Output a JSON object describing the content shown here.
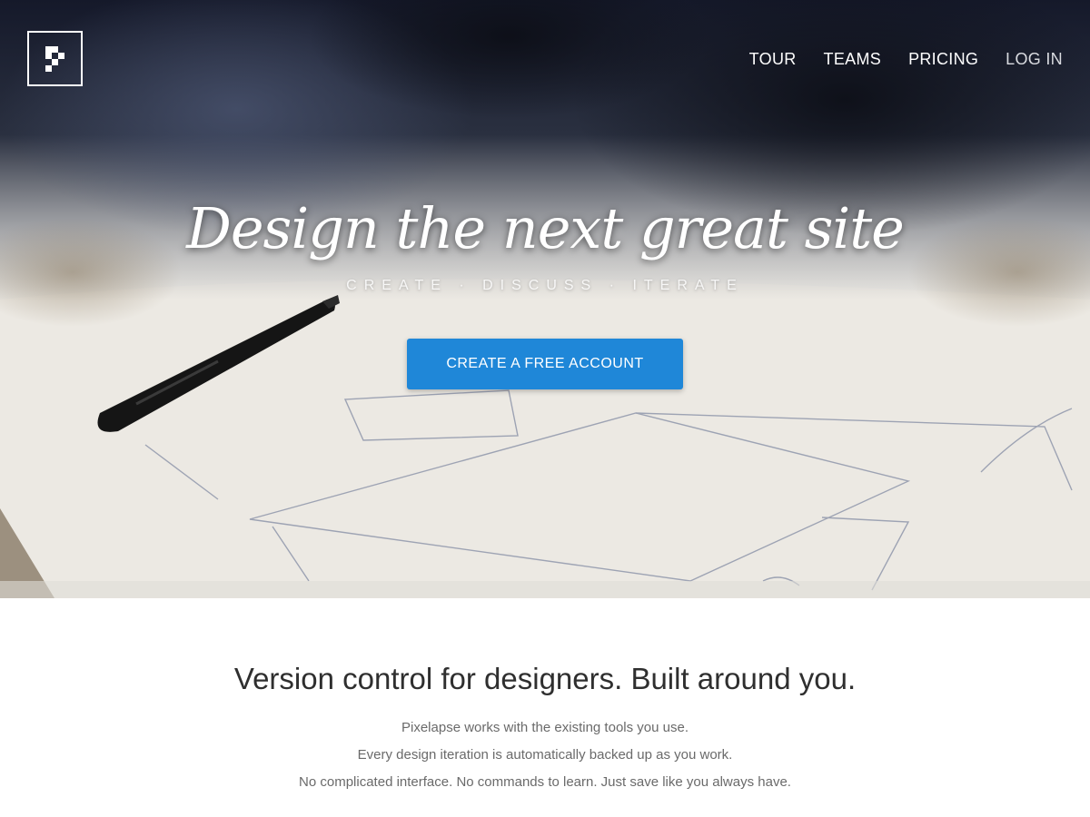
{
  "nav": {
    "items": [
      {
        "label": "TOUR"
      },
      {
        "label": "TEAMS"
      },
      {
        "label": "PRICING"
      },
      {
        "label": "LOG IN"
      }
    ]
  },
  "hero": {
    "headline": "Design the next great site",
    "tagline": "CREATE · DISCUSS · ITERATE",
    "cta_label": "CREATE A FREE ACCOUNT"
  },
  "intro": {
    "heading": "Version control for designers. Built around you.",
    "lines": [
      "Pixelapse works with the existing tools you use.",
      "Every design iteration is automatically backed up as you work.",
      "No complicated interface. No commands to learn. Just save like you always have."
    ]
  },
  "colors": {
    "accent": "#1f87d8",
    "heading": "#2f2f2f",
    "body_text": "#6a6a6a"
  },
  "icons": {
    "logo": "pixel-p-logo-icon",
    "pen": "pen-photo"
  }
}
